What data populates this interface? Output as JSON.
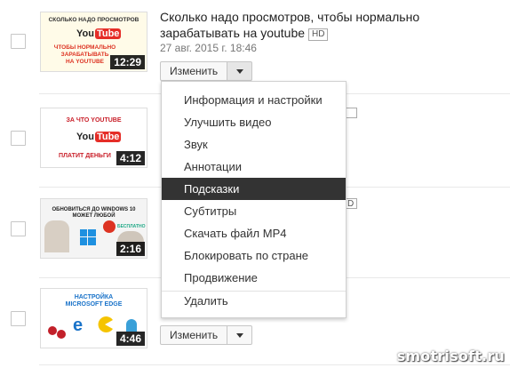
{
  "videos": [
    {
      "title": "Сколько надо просмотров, чтобы нормально зарабатывать на youtube",
      "badge": "HD",
      "date": "27 авг. 2015 г. 18:46",
      "duration": "12:29",
      "thumb_top": "СКОЛЬКО НАДО ПРОСМОТРОВ",
      "thumb_lines": [
        "ЧТОБЫ НОРМАЛЬНО",
        "ЗАРАБАТЫВАТЬ",
        "НА YOUTUBE"
      ],
      "logo_you": "You",
      "logo_tube": "Tube"
    },
    {
      "duration": "4:12",
      "thumb_top": "ЗА ЧТО YOUTUBE",
      "thumb_bottom": "ПЛАТИТ ДЕНЬГИ",
      "logo_you": "You",
      "logo_tube": "Tube"
    },
    {
      "duration": "2:16",
      "thumb_top": "ОБНОВИТЬСЯ ДО WINDOWS 10",
      "thumb_line2": "МОЖЕТ ЛЮБОЙ",
      "thumb_free": "БЕСПЛАТНО",
      "badge_partial": "D"
    },
    {
      "duration": "4:46",
      "thumb_top": "НАСТРОЙКА",
      "thumb_line2": "MICROSOFT EDGE",
      "edit_label": "Изменить"
    }
  ],
  "edit_button_label": "Изменить",
  "dropdown_menu": {
    "items": [
      "Информация и настройки",
      "Улучшить видео",
      "Звук",
      "Аннотации",
      "Подсказки",
      "Субтитры",
      "Скачать файл MP4",
      "Блокировать по стране",
      "Продвижение"
    ],
    "selected": "Подсказки",
    "delete_label": "Удалить"
  },
  "watermark": "smotrisoft.ru",
  "colors": {
    "menu_selected_bg": "#333333",
    "youtube_red": "#e52d27",
    "duration_bg": "#000000"
  },
  "icons": [
    "chevron-down-icon",
    "checkbox"
  ]
}
